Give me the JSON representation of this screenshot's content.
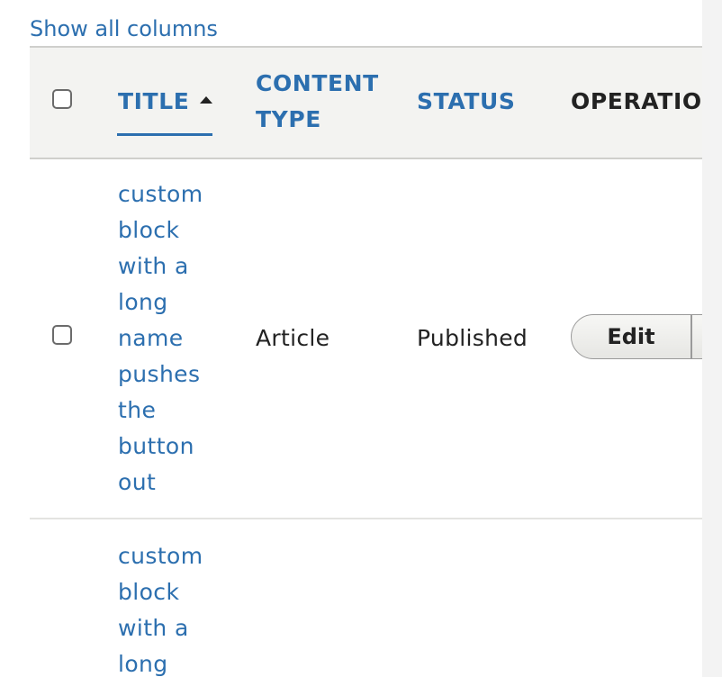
{
  "show_all_columns": "Show all columns",
  "table": {
    "headers": {
      "title": "TITLE",
      "content_type_line1": "CONTENT",
      "content_type_line2": "TYPE",
      "status": "STATUS",
      "operations": "OPERATIONS"
    },
    "rows": [
      {
        "title_words": [
          "custom",
          "block",
          "with a",
          "long",
          "name",
          "pushes",
          "the",
          "button",
          "out"
        ],
        "content_type": "Article",
        "status": "Published",
        "operation_label": "Edit"
      },
      {
        "title_words": [
          "custom",
          "block",
          "with a",
          "long"
        ]
      }
    ]
  }
}
